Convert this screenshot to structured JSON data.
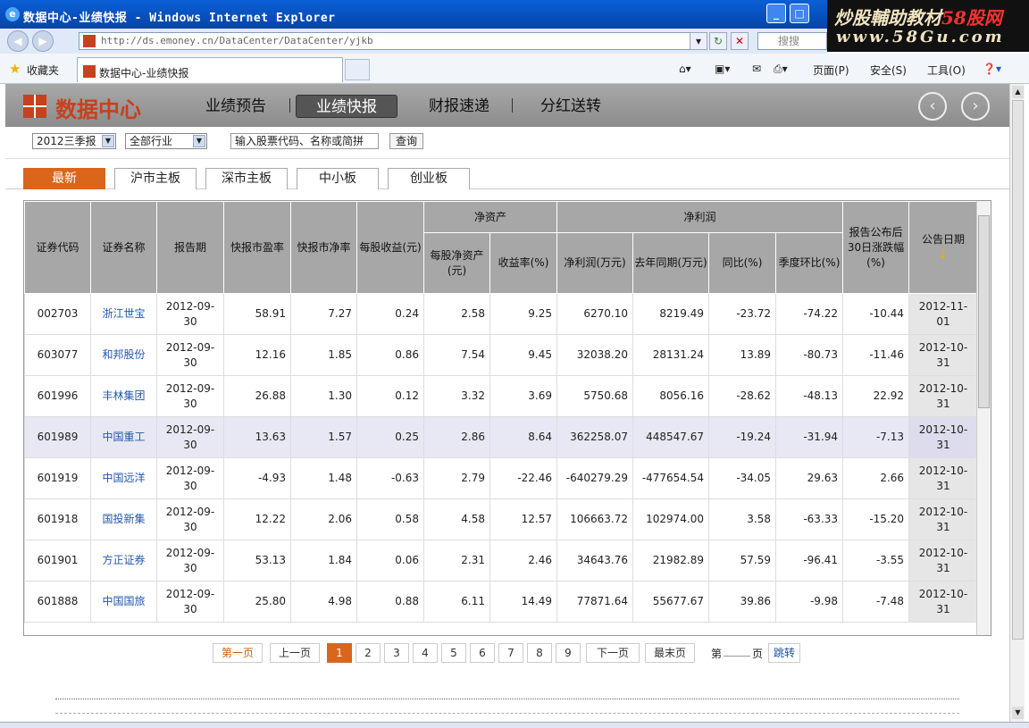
{
  "browser": {
    "title": "数据中心-业绩快报 - Windows Internet Explorer",
    "url": "http://ds.emoney.cn/DataCenter/DataCenter/yjkb",
    "search_placeholder": "搜搜",
    "favorites": "收藏夹",
    "tab_title": "数据中心-业绩快报",
    "toolbar": [
      "页面(P)",
      "安全(S)",
      "工具(O)"
    ],
    "watermark_main": "炒股輔助教材",
    "watermark_brand": "58股网",
    "watermark_url": "www.58Gu.com"
  },
  "header": {
    "logo": "数据中心",
    "nav": [
      "业绩预告",
      "业绩快报",
      "财报速递",
      "分红送转"
    ],
    "active_nav": "业绩快报",
    "prev_icon": "arrow-left-circle-icon",
    "next_icon": "arrow-right-circle-icon"
  },
  "filters": {
    "period": "2012三季报",
    "industry": "全部行业",
    "keyword_placeholder": "输入股票代码、名称或简拼",
    "query": "查询"
  },
  "board_tabs": [
    "最新",
    "沪市主板",
    "深市主板",
    "中小板",
    "创业板"
  ],
  "table": {
    "h": {
      "code": "证券代码",
      "name": "证券名称",
      "period": "报告期",
      "pe": "快报市盈率",
      "pb": "快报市净率",
      "eps": "每股收益(元)",
      "net_assets": "净资产",
      "bvps": "每股净资产(元)",
      "roe": "收益率(%)",
      "net_profit": "净利润",
      "np": "净利润(万元)",
      "np_last": "去年同期(万元)",
      "yoy": "同比(%)",
      "qoq": "季度环比(%)",
      "change30": "报告公布后30日涨跌幅(%)",
      "pub_date": "公告日期"
    },
    "rows": [
      {
        "code": "002703",
        "name": "浙江世宝",
        "period": "2012-09-30",
        "pe": "58.91",
        "pb": "7.27",
        "eps": "0.24",
        "bvps": "2.58",
        "roe": "9.25",
        "np": "6270.10",
        "np_last": "8219.49",
        "yoy": "-23.72",
        "qoq": "-74.22",
        "chg": "-10.44",
        "date": "2012-11-01"
      },
      {
        "code": "603077",
        "name": "和邦股份",
        "period": "2012-09-30",
        "pe": "12.16",
        "pb": "1.85",
        "eps": "0.86",
        "bvps": "7.54",
        "roe": "9.45",
        "np": "32038.20",
        "np_last": "28131.24",
        "yoy": "13.89",
        "qoq": "-80.73",
        "chg": "-11.46",
        "date": "2012-10-31"
      },
      {
        "code": "601996",
        "name": "丰林集团",
        "period": "2012-09-30",
        "pe": "26.88",
        "pb": "1.30",
        "eps": "0.12",
        "bvps": "3.32",
        "roe": "3.69",
        "np": "5750.68",
        "np_last": "8056.16",
        "yoy": "-28.62",
        "qoq": "-48.13",
        "chg": "22.92",
        "date": "2012-10-31"
      },
      {
        "code": "601989",
        "name": "中国重工",
        "period": "2012-09-30",
        "pe": "13.63",
        "pb": "1.57",
        "eps": "0.25",
        "bvps": "2.86",
        "roe": "8.64",
        "np": "362258.07",
        "np_last": "448547.67",
        "yoy": "-19.24",
        "qoq": "-31.94",
        "chg": "-7.13",
        "date": "2012-10-31"
      },
      {
        "code": "601919",
        "name": "中国远洋",
        "period": "2012-09-30",
        "pe": "-4.93",
        "pb": "1.48",
        "eps": "-0.63",
        "bvps": "2.79",
        "roe": "-22.46",
        "np": "-640279.29",
        "np_last": "-477654.54",
        "yoy": "-34.05",
        "qoq": "29.63",
        "chg": "2.66",
        "date": "2012-10-31"
      },
      {
        "code": "601918",
        "name": "国投新集",
        "period": "2012-09-30",
        "pe": "12.22",
        "pb": "2.06",
        "eps": "0.58",
        "bvps": "4.58",
        "roe": "12.57",
        "np": "106663.72",
        "np_last": "102974.00",
        "yoy": "3.58",
        "qoq": "-63.33",
        "chg": "-15.20",
        "date": "2012-10-31"
      },
      {
        "code": "601901",
        "name": "方正证券",
        "period": "2012-09-30",
        "pe": "53.13",
        "pb": "1.84",
        "eps": "0.06",
        "bvps": "2.31",
        "roe": "2.46",
        "np": "34643.76",
        "np_last": "21982.89",
        "yoy": "57.59",
        "qoq": "-96.41",
        "chg": "-3.55",
        "date": "2012-10-31"
      },
      {
        "code": "601888",
        "name": "中国国旅",
        "period": "2012-09-30",
        "pe": "25.80",
        "pb": "4.98",
        "eps": "0.88",
        "bvps": "6.11",
        "roe": "14.49",
        "np": "77871.64",
        "np_last": "55677.67",
        "yoy": "39.86",
        "qoq": "-9.98",
        "chg": "-7.48",
        "date": "2012-10-31"
      }
    ],
    "highlight_row": 3
  },
  "pager": {
    "first": "第一页",
    "prev": "上一页",
    "pages": [
      "1",
      "2",
      "3",
      "4",
      "5",
      "6",
      "7",
      "8",
      "9"
    ],
    "current": "1",
    "next": "下一页",
    "last": "最末页",
    "goto_prefix": "第",
    "goto_suffix": "页",
    "goto_btn": "跳转"
  }
}
